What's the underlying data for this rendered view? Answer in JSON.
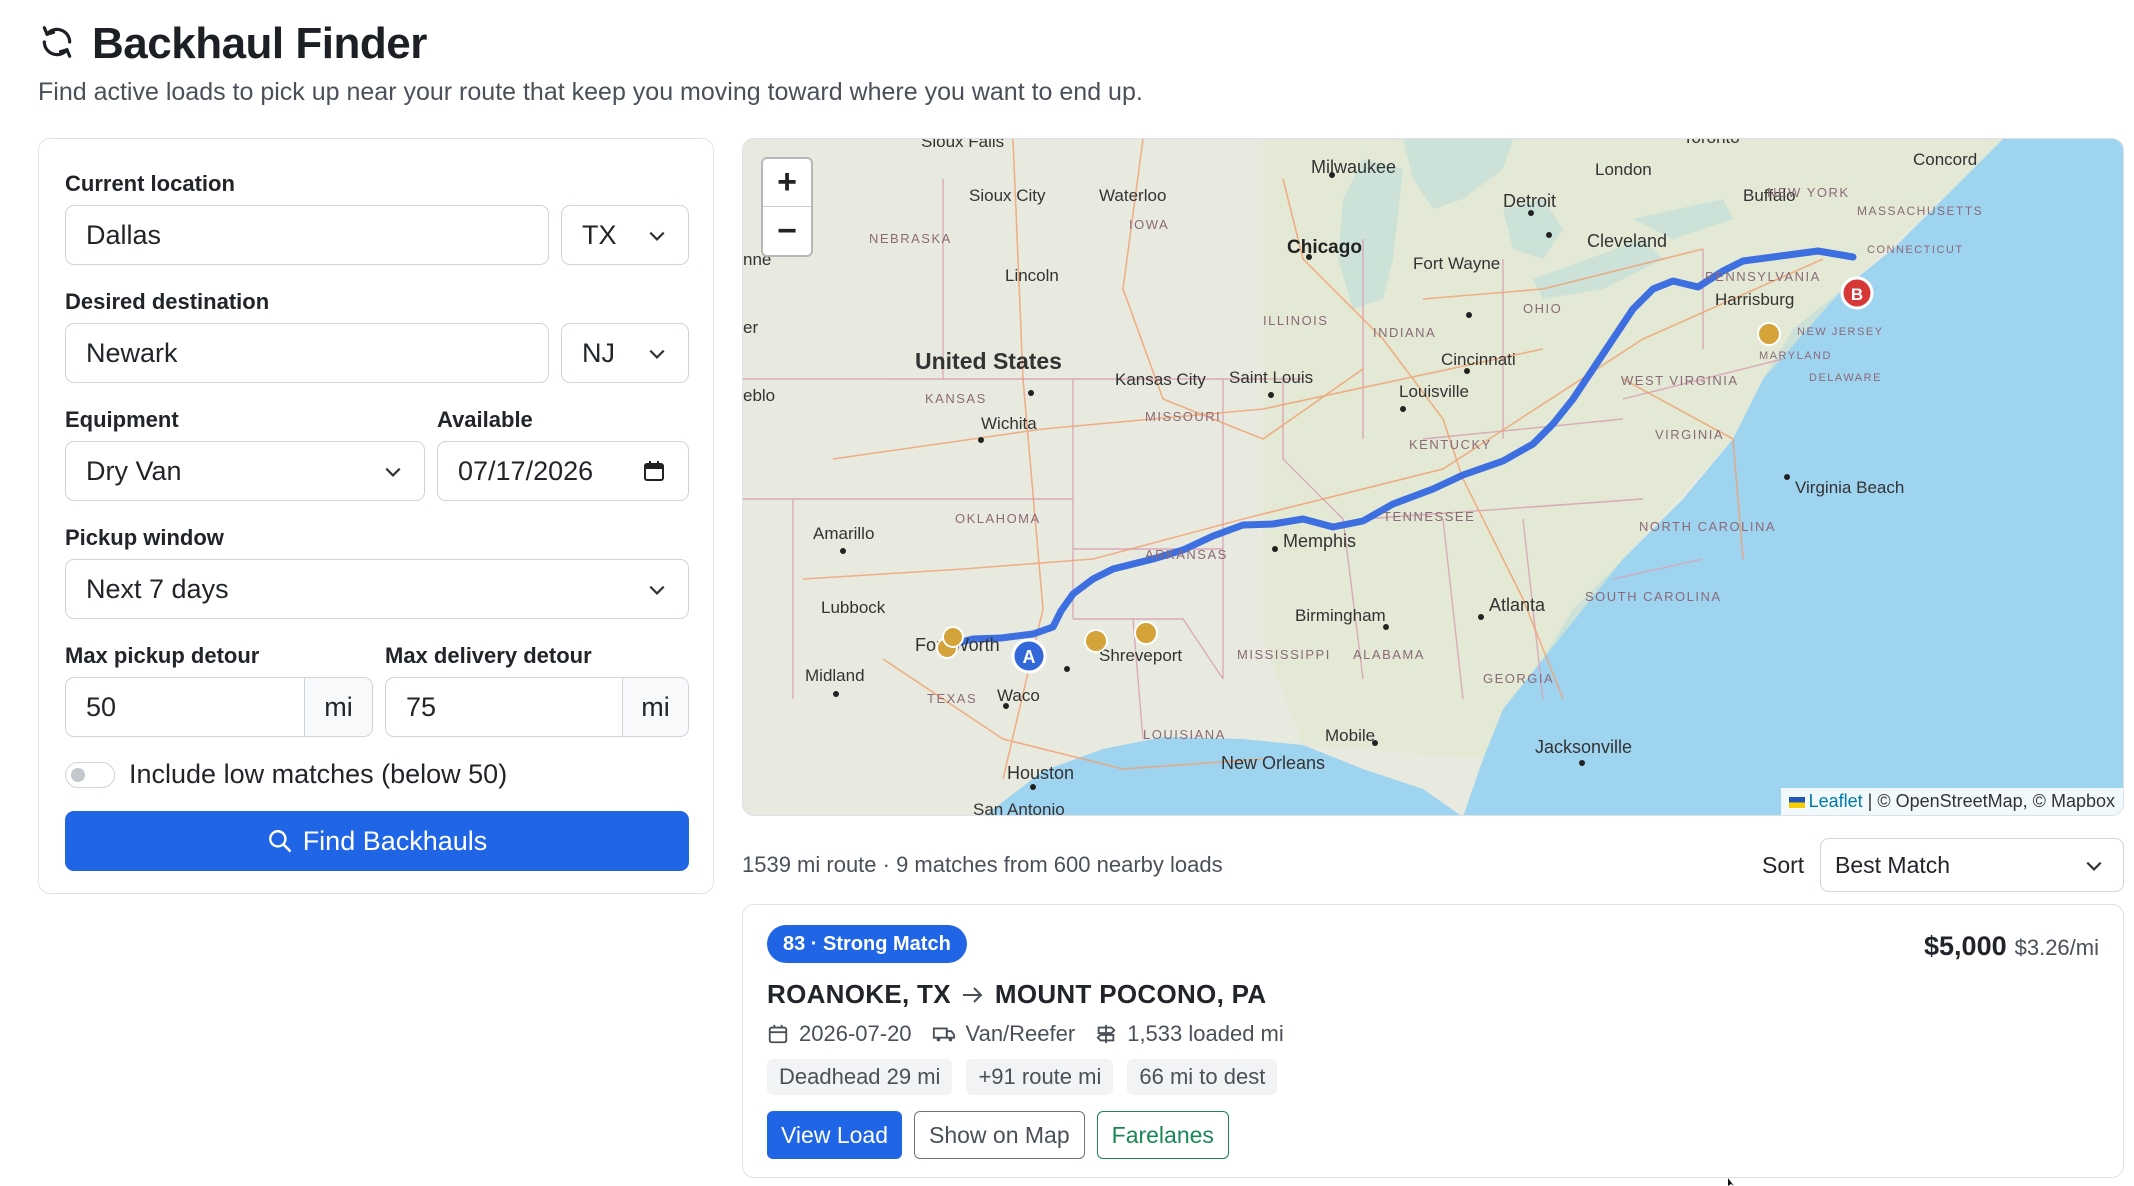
{
  "header": {
    "title": "Backhaul Finder",
    "subtitle": "Find active loads to pick up near your route that keep you moving toward where you want to end up."
  },
  "form": {
    "current_location_label": "Current location",
    "current_city": "Dallas",
    "current_state": "TX",
    "destination_label": "Desired destination",
    "destination_city": "Newark",
    "destination_state": "NJ",
    "equipment_label": "Equipment",
    "equipment_value": "Dry Van",
    "available_label": "Available",
    "available_value": "07/17/2026",
    "pickup_window_label": "Pickup window",
    "pickup_window_value": "Next 7 days",
    "max_pickup_label": "Max pickup detour",
    "max_pickup_value": "50",
    "max_pickup_unit": "mi",
    "max_delivery_label": "Max delivery detour",
    "max_delivery_value": "75",
    "max_delivery_unit": "mi",
    "low_matches_label": "Include low matches (below 50)",
    "low_matches_on": false,
    "find_button": "Find Backhauls"
  },
  "map": {
    "zoom_in": "+",
    "zoom_out": "−",
    "marker_a": "A",
    "marker_b": "B",
    "attribution_leaflet": "Leaflet",
    "attribution_rest": "| © OpenStreetMap, © Mapbox",
    "labels": {
      "country": "United States",
      "sioux_falls": "Sioux Falls",
      "sioux_city": "Sioux City",
      "waterloo": "Waterloo",
      "milwaukee": "Milwaukee",
      "toronto": "Toronto",
      "london": "London",
      "concord": "Concord",
      "buffalo": "Buffalo",
      "detroit": "Detroit",
      "chicago": "Chicago",
      "fort_wayne": "Fort Wayne",
      "cleveland": "Cleveland",
      "lincoln": "Lincoln",
      "harrisburg": "Harrisburg",
      "kansas_city": "Kansas City",
      "saint_louis": "Saint Louis",
      "cincinnati": "Cincinnati",
      "wichita": "Wichita",
      "louisville": "Louisville",
      "virginia_beach": "Virginia Beach",
      "amarillo": "Amarillo",
      "memphis": "Memphis",
      "lubbock": "Lubbock",
      "birmingham": "Birmingham",
      "atlanta": "Atlanta",
      "fort_worth": "Fort Worth",
      "shreveport": "Shreveport",
      "midland": "Midland",
      "waco": "Waco",
      "mobile": "Mobile",
      "jacksonville": "Jacksonville",
      "new_orleans": "New Orleans",
      "houston": "Houston",
      "san_antonio": "San Antonio",
      "nebraska": "NEBRASKA",
      "iowa": "IOWA",
      "new_york": "NEW YORK",
      "massachusetts": "MASSACHUSETTS",
      "connecticut": "CONNECTICUT",
      "pennsylvania": "PENNSYLVANIA",
      "ohio": "OHIO",
      "indiana": "INDIANA",
      "illinois": "ILLINOIS",
      "new_jersey": "NEW JERSEY",
      "maryland": "MARYLAND",
      "delaware": "DELAWARE",
      "kansas": "KANSAS",
      "missouri": "MISSOURI",
      "west_virginia": "WEST VIRGINIA",
      "virginia": "VIRGINIA",
      "kentucky": "KENTUCKY",
      "tennessee": "TENNESSEE",
      "north_carolina": "NORTH CAROLINA",
      "oklahoma": "OKLAHOMA",
      "arkansas": "ARKANSAS",
      "south_carolina": "SOUTH CAROLINA",
      "mississippi": "MISSISSIPPI",
      "alabama": "ALABAMA",
      "georgia": "GEORGIA",
      "texas": "TEXAS",
      "louisiana": "LOUISIANA",
      "nne": "nne",
      "er": "er",
      "eblo": "eblo"
    }
  },
  "results": {
    "summary": "1539 mi route · 9 matches from 600 nearby loads",
    "sort_label": "Sort",
    "sort_value": "Best Match",
    "card": {
      "badge": "83 · Strong Match",
      "price": "$5,000",
      "rate": "$3.26/mi",
      "origin": "ROANOKE, TX",
      "destination": "MOUNT POCONO, PA",
      "date": "2026-07-20",
      "equipment": "Van/Reefer",
      "loaded": "1,533 loaded mi",
      "chips": [
        "Deadhead 29 mi",
        "+91 route mi",
        "66 mi to dest"
      ],
      "view_btn": "View Load",
      "map_btn": "Show on Map",
      "fare_btn": "Farelanes"
    }
  },
  "colors": {
    "primary": "#1f65e6",
    "route": "#3d6fe0",
    "marker_a": "#3268d8",
    "marker_b": "#d63838",
    "pickup_marker": "#d4a43a",
    "water": "#9fd4f0",
    "land": "#e9eadf"
  }
}
